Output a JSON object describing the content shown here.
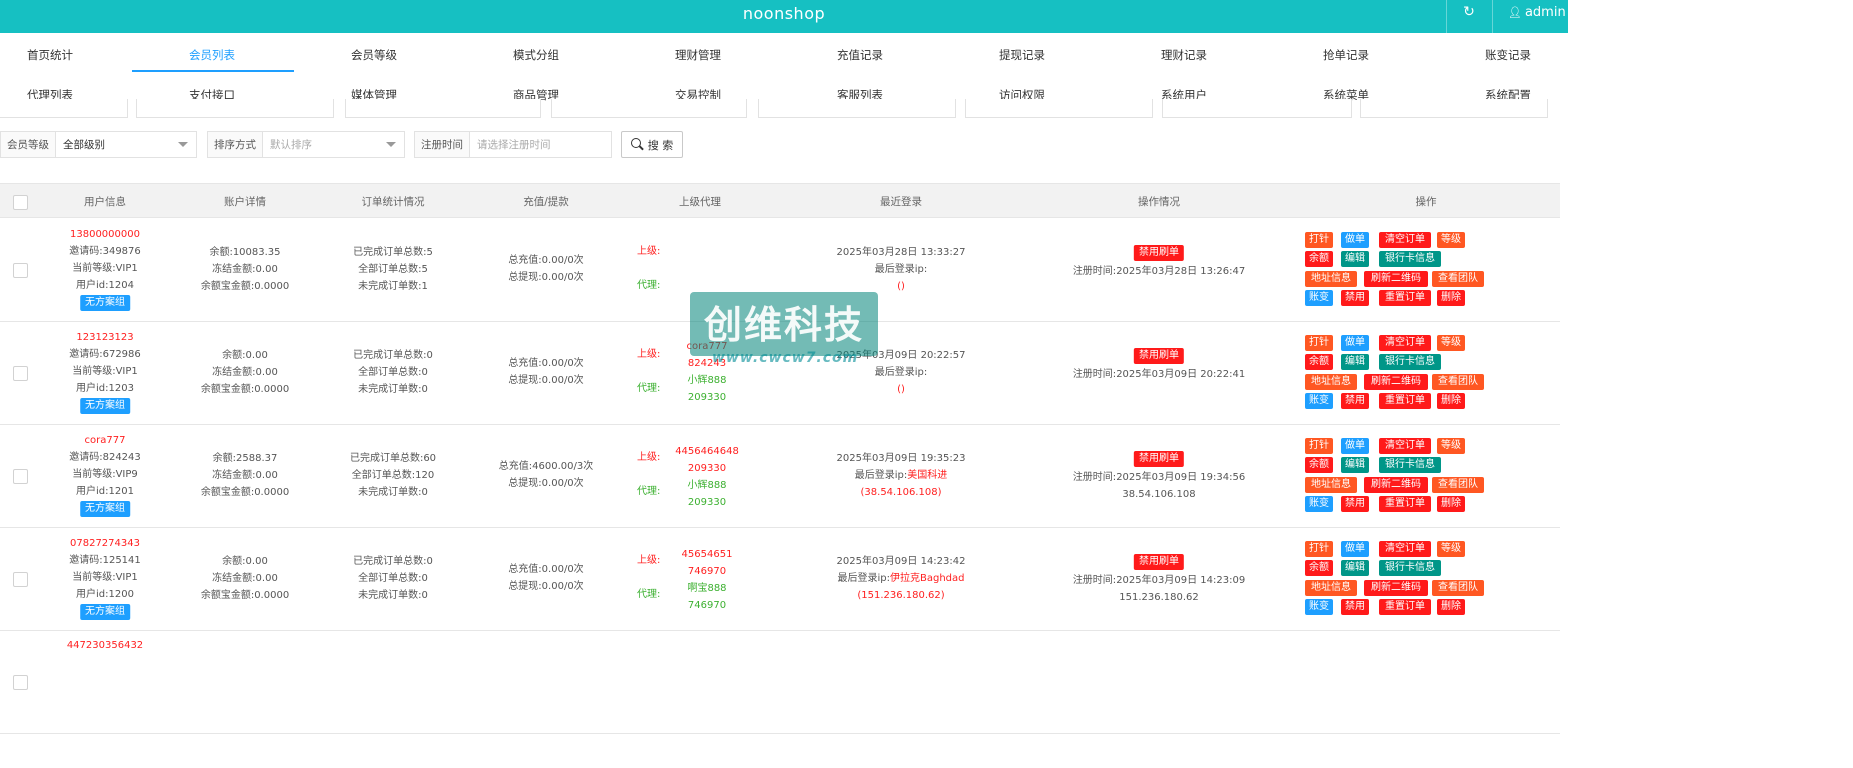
{
  "header": {
    "title": "noonshop",
    "user": "admin",
    "refresh_icon": "refresh-icon",
    "user_icon": "user-icon"
  },
  "nav": {
    "row1": [
      "首页统计",
      "会员列表",
      "会员等级",
      "模式分组",
      "理财管理",
      "充值记录",
      "提现记录",
      "理财记录",
      "抢单记录",
      "账变记录"
    ],
    "row2": [
      "代理列表",
      "支付接口",
      "媒体管理",
      "商品管理",
      "交易控制",
      "客服列表",
      "访问权限",
      "系统用户",
      "系统菜单",
      "系统配置"
    ],
    "active": "会员列表"
  },
  "filters": {
    "level_label": "会员等级",
    "level_value": "全部级别",
    "sort_label": "排序方式",
    "sort_placeholder": "默认排序",
    "time_label": "注册时间",
    "time_placeholder": "请选择注册时间",
    "search_label": "搜 索"
  },
  "table": {
    "headers": [
      "用户信息",
      "账户详情",
      "订单统计情况",
      "充值/提款",
      "上级代理",
      "最近登录",
      "操作情况",
      "操作"
    ],
    "actions": [
      "打针",
      "做单",
      "清空订单",
      "等级",
      "余额",
      "编辑",
      "银行卡信息",
      "地址信息",
      "刷新二维码",
      "查看团队",
      "账变",
      "禁用",
      "重置订单",
      "删除"
    ],
    "rows": [
      {
        "phone": "13800000000",
        "invite": "邀请码:349876",
        "level": "当前等级:VIP1",
        "uid": "用户id:1204",
        "group": "无方案组",
        "balance": "余额:10083.35",
        "frozen": "冻结金额:0.00",
        "yeb": "余额宝金额:0.0000",
        "done": "已完成订单总数:5",
        "all": "全部订单总数:5",
        "undone": "未完成订单数:1",
        "recharge": "总充值:0.00/0次",
        "withdraw": "总提现:0.00/0次",
        "sup_label": "上级:",
        "agent_label": "代理:",
        "sup": [],
        "agent": [],
        "login_time": "2025年03月28日 13:33:27",
        "login_ip_label": "最后登录ip:",
        "login_loc": "",
        "login_ip": "()",
        "banned": "禁用刷单",
        "reg_label": "注册时间:",
        "reg_time": "2025年03月28日 13:26:47",
        "reg_ip": ""
      },
      {
        "phone": "123123123",
        "invite": "邀请码:672986",
        "level": "当前等级:VIP1",
        "uid": "用户id:1203",
        "group": "无方案组",
        "balance": "余额:0.00",
        "frozen": "冻结金额:0.00",
        "yeb": "余额宝金额:0.0000",
        "done": "已完成订单总数:0",
        "all": "全部订单总数:0",
        "undone": "未完成订单数:0",
        "recharge": "总充值:0.00/0次",
        "withdraw": "总提现:0.00/0次",
        "sup_label": "上级:",
        "agent_label": "代理:",
        "sup": [
          "cora777",
          "824243"
        ],
        "agent": [
          "小辉888",
          "209330"
        ],
        "login_time": "2025年03月09日 20:22:57",
        "login_ip_label": "最后登录ip:",
        "login_loc": "",
        "login_ip": "()",
        "banned": "禁用刷单",
        "reg_label": "注册时间:",
        "reg_time": "2025年03月09日 20:22:41",
        "reg_ip": ""
      },
      {
        "phone": "cora777",
        "invite": "邀请码:824243",
        "level": "当前等级:VIP9",
        "uid": "用户id:1201",
        "group": "无方案组",
        "balance": "余额:2588.37",
        "frozen": "冻结金额:0.00",
        "yeb": "余额宝金额:0.0000",
        "done": "已完成订单总数:60",
        "all": "全部订单总数:120",
        "undone": "未完成订单数:0",
        "recharge": "总充值:4600.00/3次",
        "withdraw": "总提现:0.00/0次",
        "sup_label": "上级:",
        "agent_label": "代理:",
        "sup": [
          "4456464648",
          "209330"
        ],
        "agent": [
          "小辉888",
          "209330"
        ],
        "login_time": "2025年03月09日 19:35:23",
        "login_ip_label": "最后登录ip:",
        "login_loc": "美国科进",
        "login_ip": "(38.54.106.108)",
        "banned": "禁用刷单",
        "reg_label": "注册时间:",
        "reg_time": "2025年03月09日 19:34:56",
        "reg_ip": "38.54.106.108"
      },
      {
        "phone": "07827274343",
        "invite": "邀请码:125141",
        "level": "当前等级:VIP1",
        "uid": "用户id:1200",
        "group": "无方案组",
        "balance": "余额:0.00",
        "frozen": "冻结金额:0.00",
        "yeb": "余额宝金额:0.0000",
        "done": "已完成订单总数:0",
        "all": "全部订单总数:0",
        "undone": "未完成订单数:0",
        "recharge": "总充值:0.00/0次",
        "withdraw": "总提现:0.00/0次",
        "sup_label": "上级:",
        "agent_label": "代理:",
        "sup": [
          "45654651",
          "746970"
        ],
        "agent": [
          "啊宝888",
          "746970"
        ],
        "login_time": "2025年03月09日 14:23:42",
        "login_ip_label": "最后登录ip:",
        "login_loc": "伊拉克Baghdad",
        "login_ip": "(151.236.180.62)",
        "banned": "禁用刷单",
        "reg_label": "注册时间:",
        "reg_time": "2025年03月09日 14:23:09",
        "reg_ip": "151.236.180.62"
      },
      {
        "phone": "447230356432"
      }
    ]
  },
  "watermark": {
    "text": "创维科技",
    "url": "www.cwcw7.com"
  },
  "colors": {
    "brand": "#16c0c2",
    "active": "#1e9fff",
    "danger": "#ff1a1a",
    "warn": "#ff5722",
    "teal": "#009688"
  }
}
